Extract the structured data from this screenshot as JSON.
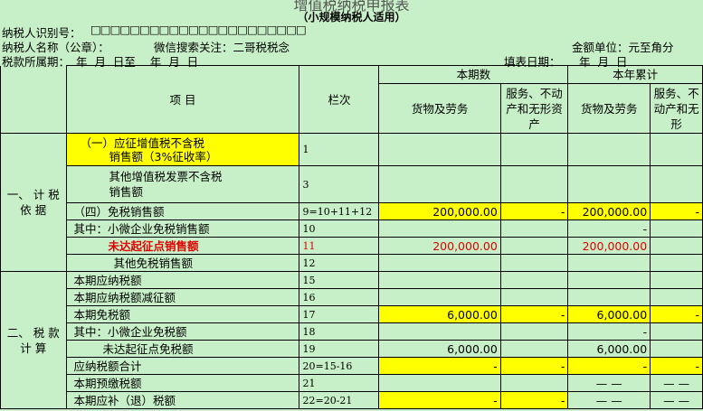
{
  "header": {
    "title": "增值税纳税申报表",
    "subtitle": "（小规模纳税人适用）",
    "taxpayer_id_label": "纳税人识别号：",
    "taxpayer_id_boxes": "□□□□□□□□□□□□□□□□□□□□□□",
    "taxpayer_name_label": "纳税人名称（公章）：",
    "taxpayer_name_value": "微信搜索关注：二哥税税念",
    "currency_unit": "金额单位：元至角分",
    "period_label": "税款所属期：",
    "period_value": "年  月  日至    年  月  日",
    "fill_date_label": "填表日期：",
    "fill_date_value": "年  月  日"
  },
  "columns": {
    "item": "项    目",
    "line_no": "栏次",
    "current_period": "本期数",
    "ytd": "本年累计",
    "goods_services": "货物及劳务",
    "services_immovable": "服务、不动产和无形资产",
    "services_immovable_ytd": "服务、不动产和无形"
  },
  "sections": {
    "s1": "一、 计 税 依 据",
    "s2": "二、 税 款 计 算"
  },
  "rows": [
    {
      "item": "（一）应征增值税不含税",
      "item2": "销售额（3%征收率）",
      "line": "1",
      "g": "",
      "s": "",
      "gy": "",
      "sy": ""
    },
    {
      "item": "其他增值税发票不含税",
      "item2": "销售额",
      "line": "3",
      "g": "",
      "s": "",
      "gy": "",
      "sy": ""
    },
    {
      "item": "（四）免税销售额",
      "line": "9=10+11+12",
      "g": "200,000.00",
      "s": "-",
      "gy": "200,000.00",
      "sy": "-"
    },
    {
      "item": "其中：小微企业免税销售额",
      "line": "10",
      "g": "",
      "s": "",
      "gy": "-",
      "sy": ""
    },
    {
      "item": "未达起征点销售额",
      "line": "11",
      "g": "200,000.00",
      "s": "",
      "gy": "200,000.00",
      "sy": ""
    },
    {
      "item": "其他免税销售额",
      "line": "12",
      "g": "",
      "s": "",
      "gy": "",
      "sy": ""
    },
    {
      "item": "本期应纳税额",
      "line": "15",
      "g": "",
      "s": "",
      "gy": "",
      "sy": ""
    },
    {
      "item": "本期应纳税额减征额",
      "line": "16",
      "g": "",
      "s": "",
      "gy": "",
      "sy": ""
    },
    {
      "item": "本期免税额",
      "line": "17",
      "g": "6,000.00",
      "s": "-",
      "gy": "6,000.00",
      "sy": "-"
    },
    {
      "item": "其中：小微企业免税额",
      "line": "18",
      "g": "",
      "s": "",
      "gy": "-",
      "sy": ""
    },
    {
      "item": "未达起征点免税额",
      "line": "19",
      "g": "6,000.00",
      "s": "",
      "gy": "6,000.00",
      "sy": ""
    },
    {
      "item": "应纳税额合计",
      "line": "20=15-16",
      "g": "-",
      "s": "-",
      "gy": "-",
      "sy": "-"
    },
    {
      "item": "本期预缴税额",
      "line": "21",
      "g": "",
      "s": "",
      "gy": "— —",
      "sy": "— —"
    },
    {
      "item": "本期应补（退）税额",
      "line": "22=20-21",
      "g": "-",
      "s": "-",
      "gy": "— —",
      "sy": "— —"
    }
  ]
}
